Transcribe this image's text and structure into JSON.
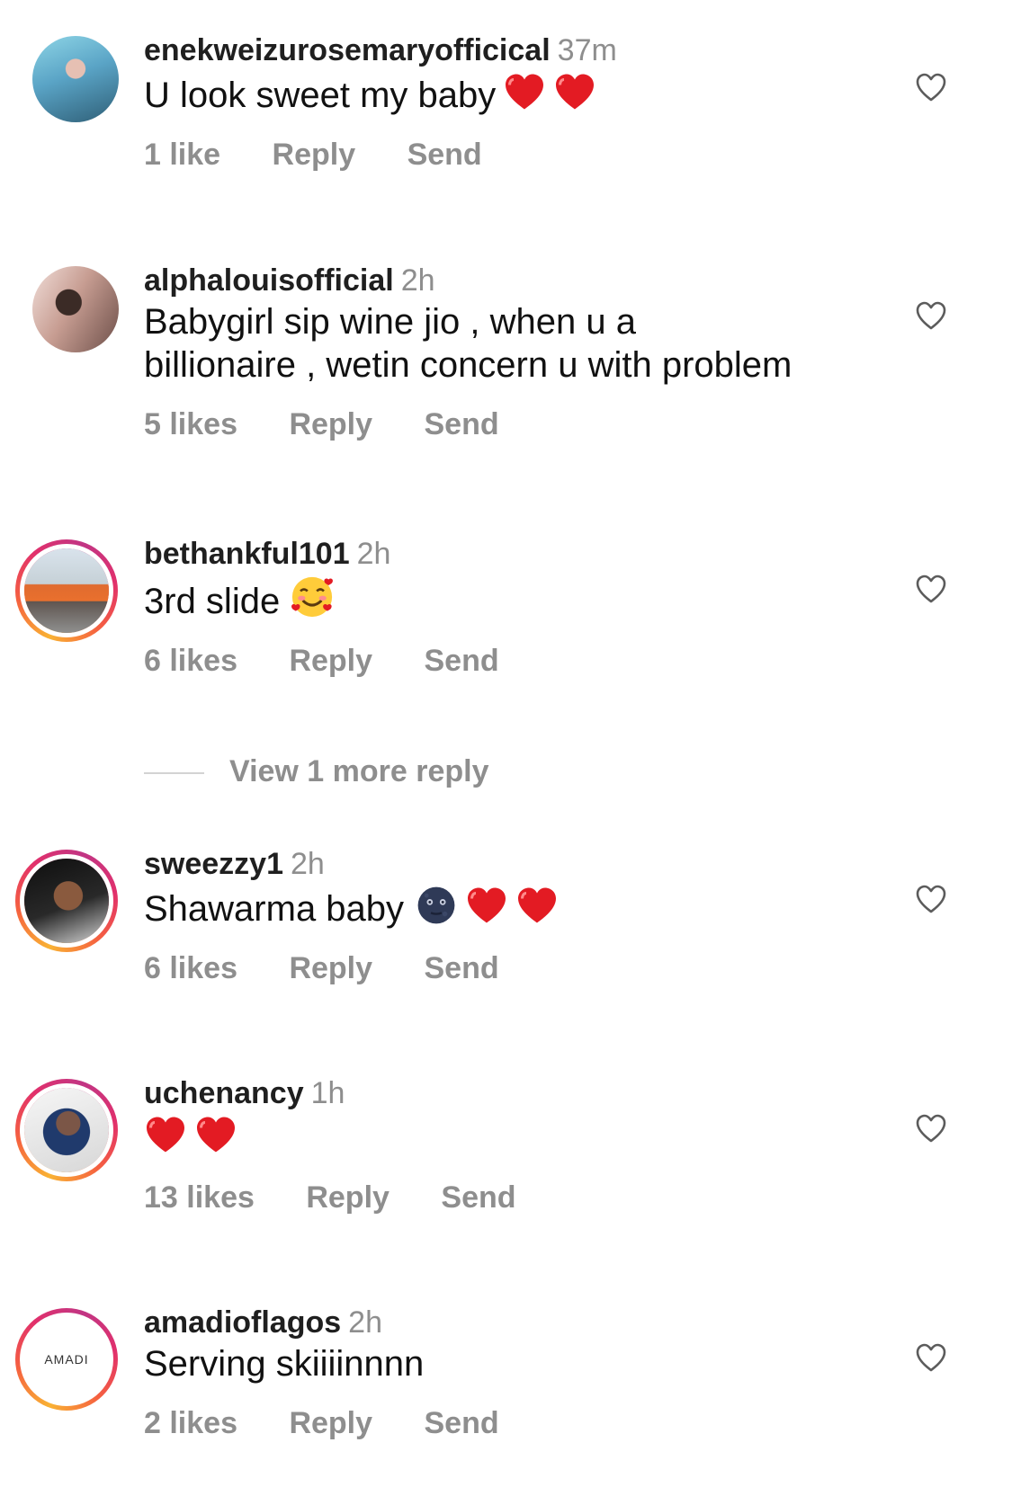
{
  "comments": [
    {
      "username": "enekweizurosemaryofficical",
      "time": "37m",
      "text": "U look sweet my baby",
      "emojis": [
        "heart",
        "heart"
      ],
      "likes": "1 like",
      "reply_label": "Reply",
      "send_label": "Send"
    },
    {
      "username": "alphalouisofficial",
      "time": "2h",
      "text_line1": "Babygirl sip wine jio , when u a",
      "text_line2": "billionaire , wetin concern u with problem",
      "likes": "5 likes",
      "reply_label": "Reply",
      "send_label": "Send"
    },
    {
      "username": "bethankful101",
      "time": "2h",
      "text": "3rd slide",
      "emojis": [
        "smiling-face-with-hearts"
      ],
      "likes": "6 likes",
      "reply_label": "Reply",
      "send_label": "Send"
    },
    {
      "username": "sweezzy1",
      "time": "2h",
      "text": "Shawarma baby",
      "emojis": [
        "new-moon-face",
        "heart",
        "heart"
      ],
      "likes": "6 likes",
      "reply_label": "Reply",
      "send_label": "Send"
    },
    {
      "username": "uchenancy",
      "time": "1h",
      "text": "",
      "emojis": [
        "heart",
        "heart"
      ],
      "likes": "13 likes",
      "reply_label": "Reply",
      "send_label": "Send"
    },
    {
      "username": "amadioflagos",
      "time": "2h",
      "text": "Serving skiiiinnnn",
      "avatar_text": "AMADI",
      "likes": "2 likes",
      "reply_label": "Reply",
      "send_label": "Send"
    }
  ],
  "view_more_reply": "View 1 more reply",
  "colors": {
    "text_primary": "#111111",
    "text_secondary": "#8e8e8e",
    "heart_red": "#e31b23",
    "story_ring_start": "#f9b233",
    "story_ring_end": "#c13584"
  }
}
